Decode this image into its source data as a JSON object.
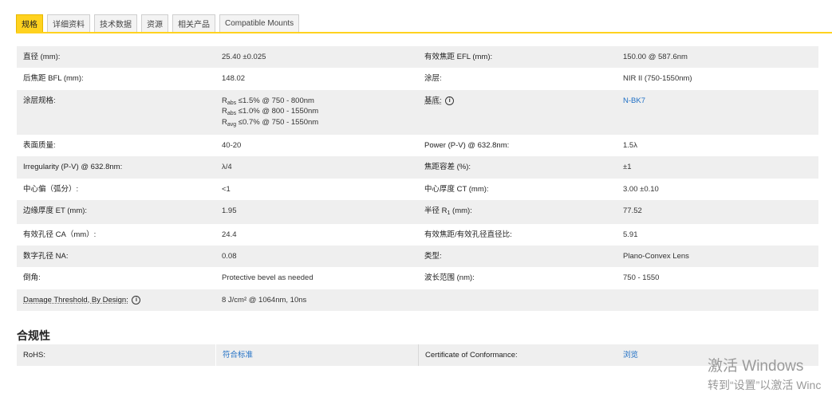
{
  "tabs": [
    "规格",
    "详细资料",
    "技术数据",
    "资源",
    "相关产品",
    "Compatible Mounts"
  ],
  "specs": {
    "r1": {
      "l1": "直径 (mm):",
      "v1": "25.40 ±0.025",
      "l2": "有效焦距 EFL (mm):",
      "v2": "150.00 @ 587.6nm"
    },
    "r2": {
      "l1": "后焦距 BFL (mm):",
      "v1": "148.02",
      "l2": "涂层:",
      "v2": "NIR II (750-1550nm)"
    },
    "r3": {
      "l1": "涂层规格:",
      "coat": [
        {
          "main": "R",
          "sub": "abs",
          "rest": " ≤1.5% @ 750 - 800nm"
        },
        {
          "main": "R",
          "sub": "abs",
          "rest": " ≤1.0% @ 800 - 1550nm"
        },
        {
          "main": "R",
          "sub": "avg",
          "rest": " ≤0.7% @ 750 - 1550nm"
        }
      ],
      "l2": "基底:",
      "info": "i",
      "v2": "N-BK7"
    },
    "r4": {
      "l1": "表面质量:",
      "v1": "40-20",
      "l2": "Power (P-V) @ 632.8nm:",
      "v2": "1.5λ"
    },
    "r5": {
      "l1": "Irregularity (P-V) @ 632.8nm:",
      "v1": "λ/4",
      "l2": "焦距容差 (%):",
      "v2": "±1"
    },
    "r6": {
      "l1": "中心偏（弧分）:",
      "v1": "<1",
      "l2": "中心厚度 CT (mm):",
      "v2": "3.00 ±0.10"
    },
    "r7": {
      "l1": "边缘厚度 ET (mm):",
      "v1": "1.95",
      "l2_pre": "半径 R",
      "l2_sub": "1",
      "l2_post": " (mm):",
      "v2": "77.52"
    },
    "r8": {
      "l1": "有效孔径 CA（mm）:",
      "v1": "24.4",
      "l2": "有效焦距/有效孔径直径比:",
      "v2": "5.91"
    },
    "r9": {
      "l1": "数字孔径 NA:",
      "v1": "0.08",
      "l2": "类型:",
      "v2": "Plano-Convex Lens"
    },
    "r10": {
      "l1": "倒角:",
      "v1": "Protective bevel as needed",
      "l2": "波长范围 (nm):",
      "v2": "750 - 1550"
    },
    "r11": {
      "l1": "Damage Threshold, By Design:",
      "info": "i",
      "v1": "8 J/cm² @ 1064nm, 10ns"
    }
  },
  "compliance": {
    "title": "合规性",
    "l1": "RoHS:",
    "v1": "符合标准",
    "l2": "Certificate of Conformance:",
    "v2": "浏览"
  },
  "watermark": {
    "line1": "激活 Windows",
    "line2": "转到“设置”以激活 Winc"
  },
  "colors": {
    "accent": "#ffd21f",
    "link": "#1f6fc5",
    "row_alt": "#efefef"
  }
}
